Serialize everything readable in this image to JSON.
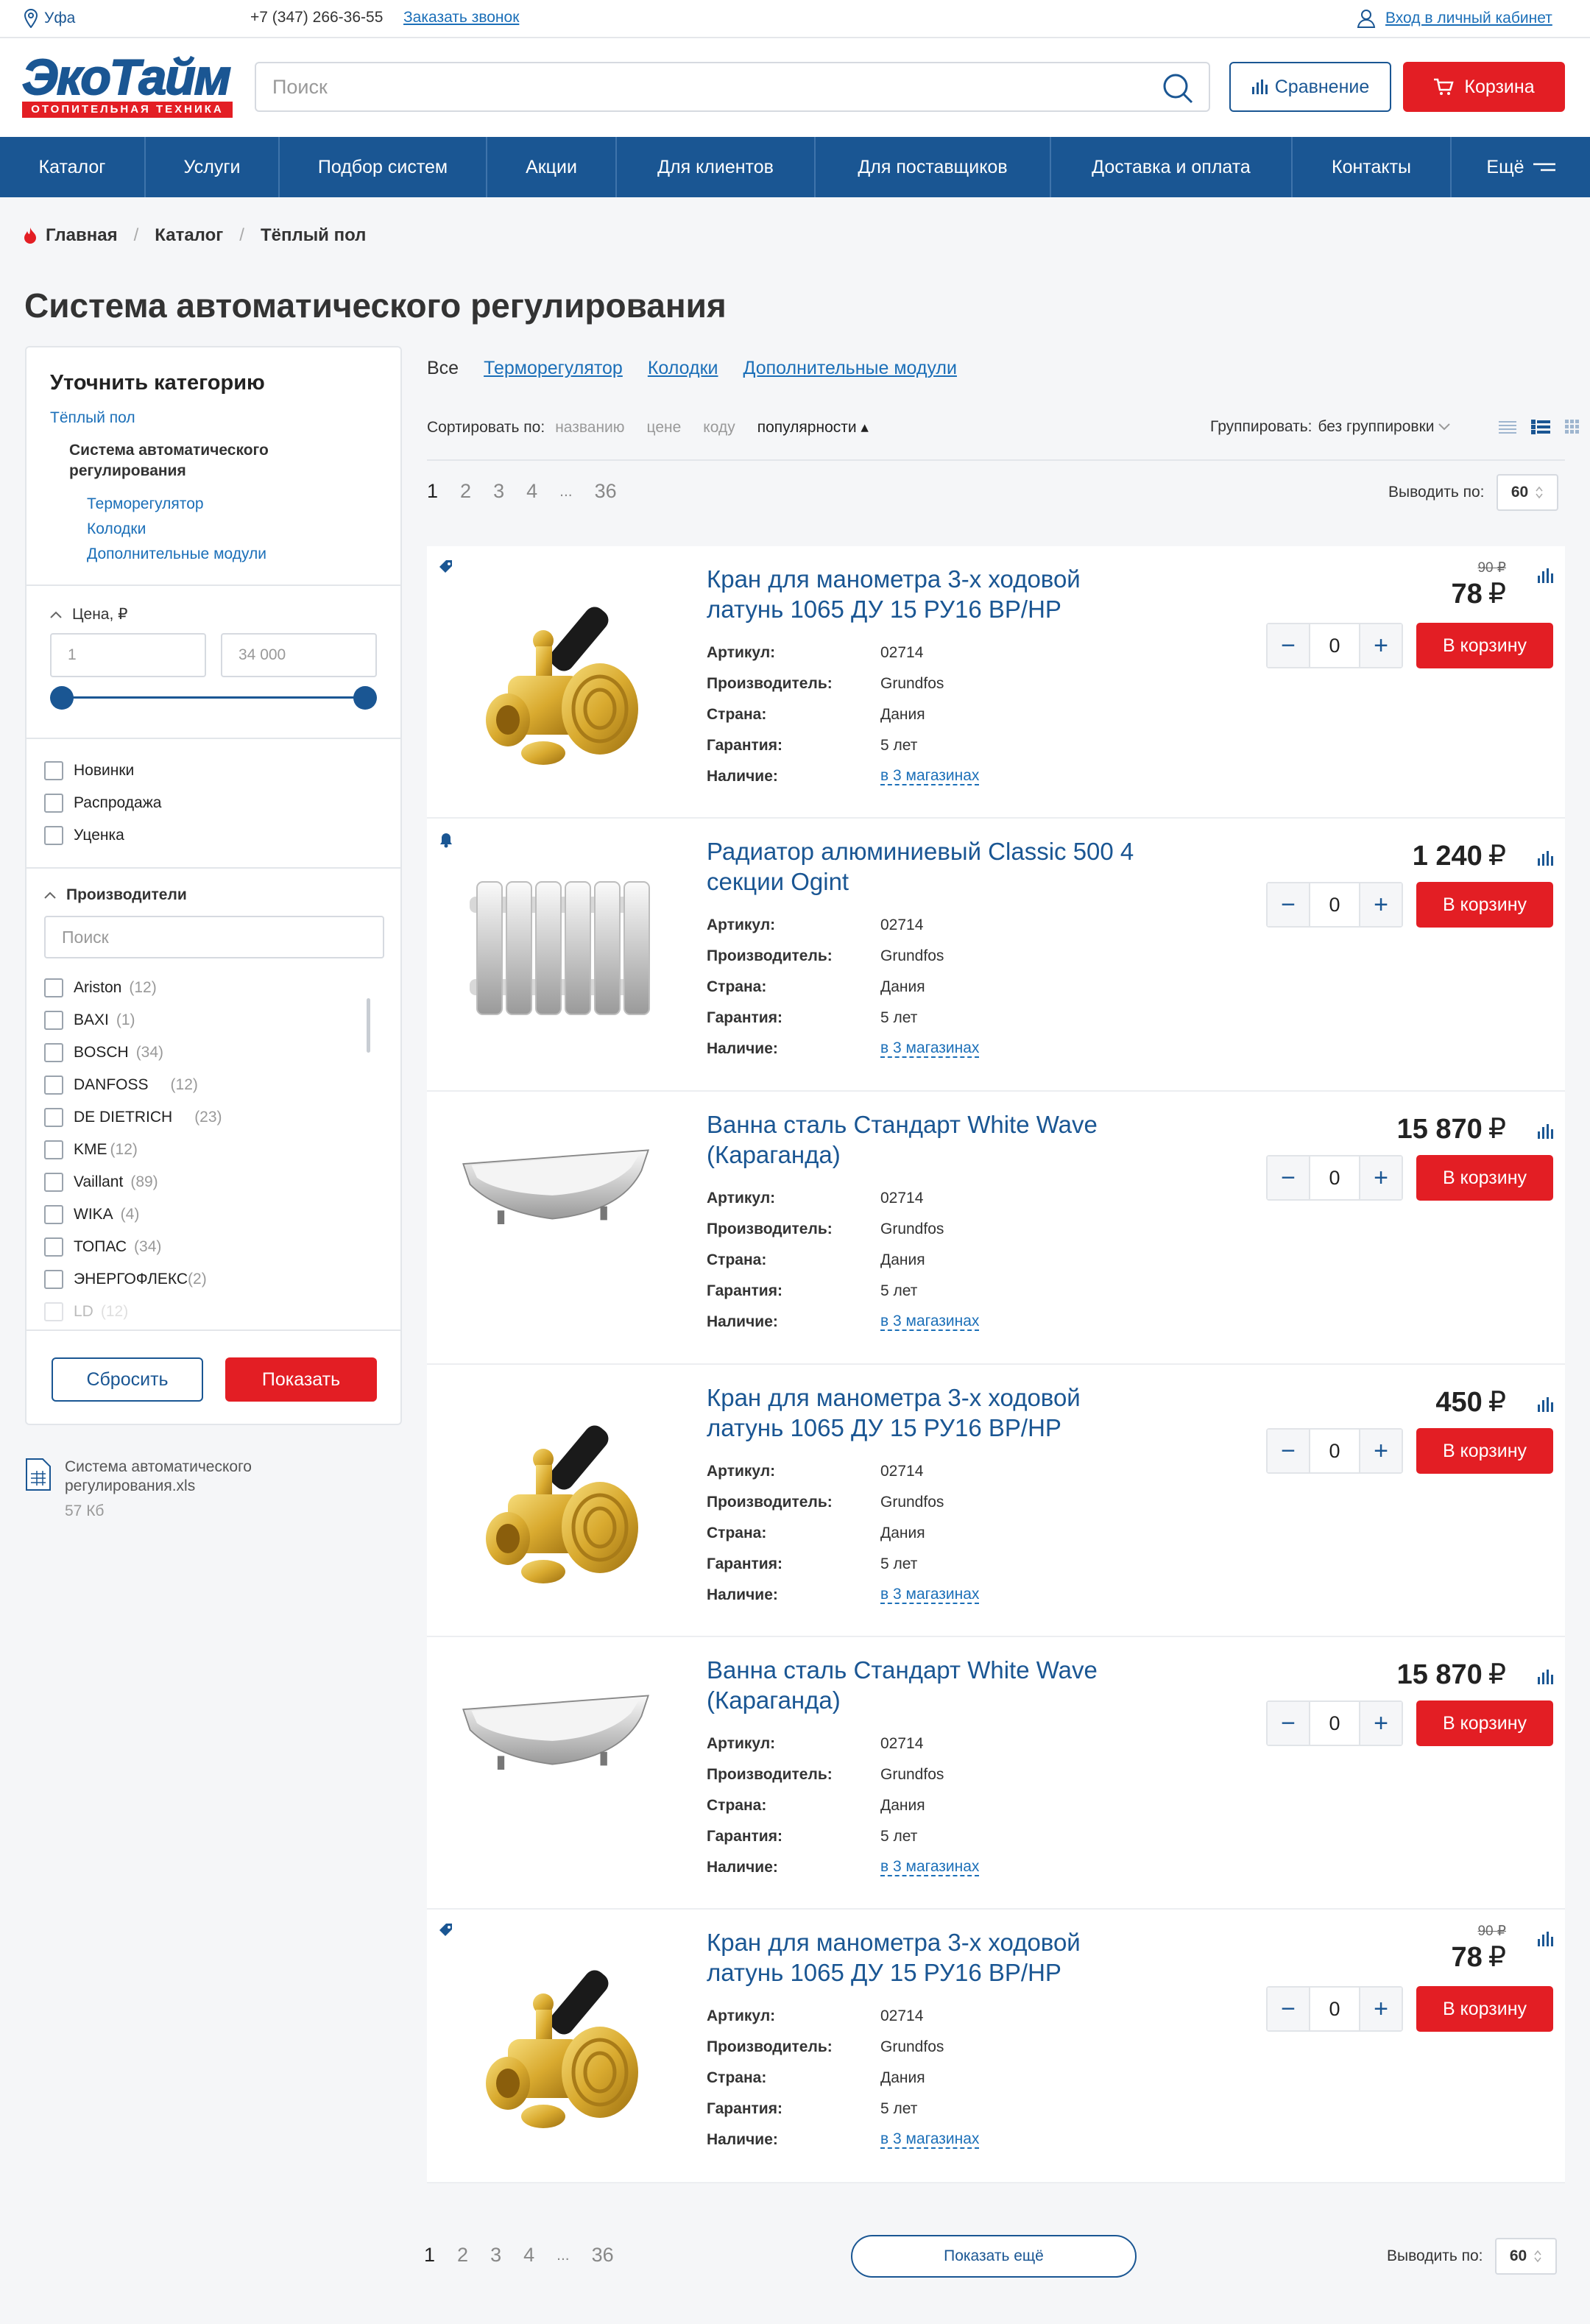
{
  "topbar": {
    "city": "Уфа",
    "phone": "+7 (347) 266-36-55",
    "callback": "Заказать звонок",
    "account": "Вход в личный кабинет"
  },
  "header": {
    "logo_text": "ЭкоТайм",
    "logo_sub": "ОТОПИТЕЛЬНАЯ ТЕХНИКА",
    "search_placeholder": "Поиск",
    "compare": "Сравнение",
    "cart": "Корзина"
  },
  "nav": [
    "Каталог",
    "Услуги",
    "Подбор систем",
    "Акции",
    "Для клиентов",
    "Для поставщиков",
    "Доставка и оплата",
    "Контакты",
    "Ещё"
  ],
  "breadcrumb": [
    "Главная",
    "Каталог",
    "Тёплый пол"
  ],
  "page_title": "Система автоматического регулирования",
  "sidebar": {
    "title": "Уточнить категорию",
    "parent": "Тёплый пол",
    "current_line1": "Система автоматического",
    "current_line2": "регулирования",
    "subcats": [
      "Терморегулятор",
      "Колодки",
      "Дополнительные модули"
    ],
    "price_label": "Цена, ₽",
    "price_min": "1",
    "price_max": "34 000",
    "flags": [
      "Новинки",
      "Распродажа",
      "Уценка"
    ],
    "brands_label": "Производители",
    "brand_search": "Поиск",
    "brands": [
      {
        "name": "Ariston",
        "count": "(12)"
      },
      {
        "name": "BAXI",
        "count": "(1)"
      },
      {
        "name": "BOSCH",
        "count": "(34)"
      },
      {
        "name": "DANFOSS",
        "count": "(12)"
      },
      {
        "name": "DE DIETRICH",
        "count": "(23)"
      },
      {
        "name": "KME",
        "count": "(12)"
      },
      {
        "name": "Vaillant",
        "count": "(89)"
      },
      {
        "name": "WIKA",
        "count": "(4)"
      },
      {
        "name": "ТОПАС",
        "count": "(34)"
      },
      {
        "name": "ЭНЕРГОФЛЕКС",
        "count": "(2)"
      },
      {
        "name": "LD",
        "count": "(12)"
      }
    ],
    "reset": "Сбросить",
    "show": "Показать",
    "file_name_1": "Система автоматического",
    "file_name_2": "регулирования.xls",
    "file_size": "57 Кб"
  },
  "tabs": [
    "Все",
    "Терморегулятор",
    "Колодки",
    "Дополнительные модули"
  ],
  "sort": {
    "label": "Сортировать по:",
    "options": [
      "названию",
      "цене",
      "коду",
      "популярности ▴"
    ],
    "group_label": "Группировать:",
    "group_value": "без группировки"
  },
  "pagination": {
    "pages": [
      "1",
      "2",
      "3",
      "4",
      "...",
      "36"
    ],
    "per_page_label": "Выводить по:",
    "per_page": "60",
    "more": "Показать ещё"
  },
  "spec_labels": {
    "art": "Артикул:",
    "maker": "Производитель:",
    "country": "Страна:",
    "warranty": "Гарантия:",
    "stock": "Наличие:"
  },
  "products": [
    {
      "title": "Кран для манометра 3-х ходовой латунь  1065 ДУ 15 РУ16 ВР/НР",
      "old_price": "90 ₽",
      "price": "78",
      "art": "02714",
      "maker": "Grundfos",
      "country": "Дания",
      "warranty": "5 лет",
      "stock": "в 3 магазинах",
      "qty": "0",
      "btn": "В корзину",
      "badge": "tag-icon",
      "img": "valve"
    },
    {
      "title": "Радиатор алюминиевый Classic 500 4 секции Ogint",
      "old_price": "",
      "price": "1 240",
      "art": "02714",
      "maker": "Grundfos",
      "country": "Дания",
      "warranty": "5 лет",
      "stock": "в 3 магазинах",
      "qty": "0",
      "btn": "В корзину",
      "badge": "bell-icon",
      "img": "radiator"
    },
    {
      "title": "Ванна сталь Стандарт White Wave (Караганда)",
      "old_price": "",
      "price": "15 870",
      "art": "02714",
      "maker": "Grundfos",
      "country": "Дания",
      "warranty": "5 лет",
      "stock": "в 3 магазинах",
      "qty": "0",
      "btn": "В корзину",
      "badge": "",
      "img": "bath"
    },
    {
      "title": "Кран для манометра 3-х ходовой латунь  1065 ДУ 15 РУ16 ВР/НР",
      "old_price": "",
      "price": "450",
      "art": "02714",
      "maker": "Grundfos",
      "country": "Дания",
      "warranty": "5 лет",
      "stock": "в 3 магазинах",
      "qty": "0",
      "btn": "В корзину",
      "badge": "",
      "img": "valve"
    },
    {
      "title": "Ванна сталь Стандарт White Wave (Караганда)",
      "old_price": "",
      "price": "15 870",
      "art": "02714",
      "maker": "Grundfos",
      "country": "Дания",
      "warranty": "5 лет",
      "stock": "в 3 магазинах",
      "qty": "0",
      "btn": "В корзину",
      "badge": "",
      "img": "bath"
    },
    {
      "title": "Кран для манометра 3-х ходовой латунь  1065 ДУ 15 РУ16 ВР/НР",
      "old_price": "90 ₽",
      "price": "78",
      "art": "02714",
      "maker": "Grundfos",
      "country": "Дания",
      "warranty": "5 лет",
      "stock": "в 3 магазинах",
      "qty": "0",
      "btn": "В корзину",
      "badge": "tag-icon",
      "img": "valve"
    }
  ],
  "currency": "₽"
}
